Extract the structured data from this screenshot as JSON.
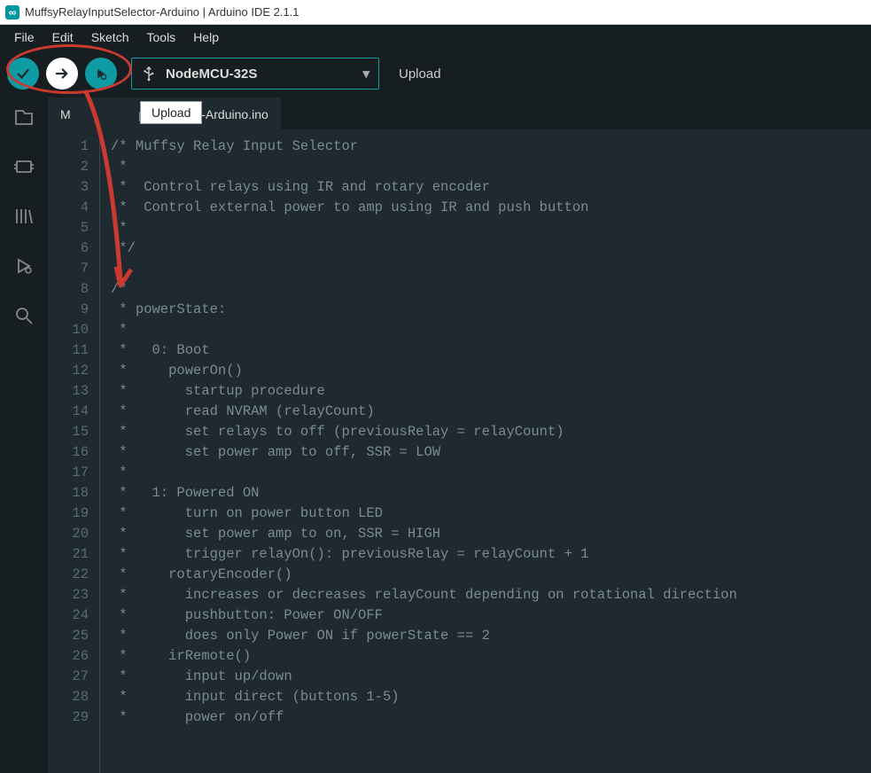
{
  "titlebar": {
    "title": "MuffsyRelayInputSelector-Arduino | Arduino IDE 2.1.1"
  },
  "menubar": {
    "items": [
      "File",
      "Edit",
      "Sketch",
      "Tools",
      "Help"
    ]
  },
  "toolbar": {
    "board": "NodeMCU-32S",
    "upload_label": "Upload",
    "tooltip": "Upload"
  },
  "tab": {
    "label_partial": "putSelector-Arduino.ino",
    "label_prefix": "M"
  },
  "code_lines": [
    "/* Muffsy Relay Input Selector",
    " *",
    " *  Control relays using IR and rotary encoder",
    " *  Control external power to amp using IR and push button",
    " *",
    " */",
    "",
    "/*",
    " * powerState:",
    " *",
    " *   0: Boot",
    " *     powerOn()",
    " *       startup procedure",
    " *       read NVRAM (relayCount)",
    " *       set relays to off (previousRelay = relayCount)",
    " *       set power amp to off, SSR = LOW",
    " *",
    " *   1: Powered ON",
    " *       turn on power button LED",
    " *       set power amp to on, SSR = HIGH",
    " *       trigger relayOn(): previousRelay = relayCount + 1",
    " *     rotaryEncoder()",
    " *       increases or decreases relayCount depending on rotational direction",
    " *       pushbutton: Power ON/OFF",
    " *       does only Power ON if powerState == 2",
    " *     irRemote()",
    " *       input up/down",
    " *       input direct (buttons 1-5)",
    " *       power on/off"
  ],
  "start_line": 1
}
